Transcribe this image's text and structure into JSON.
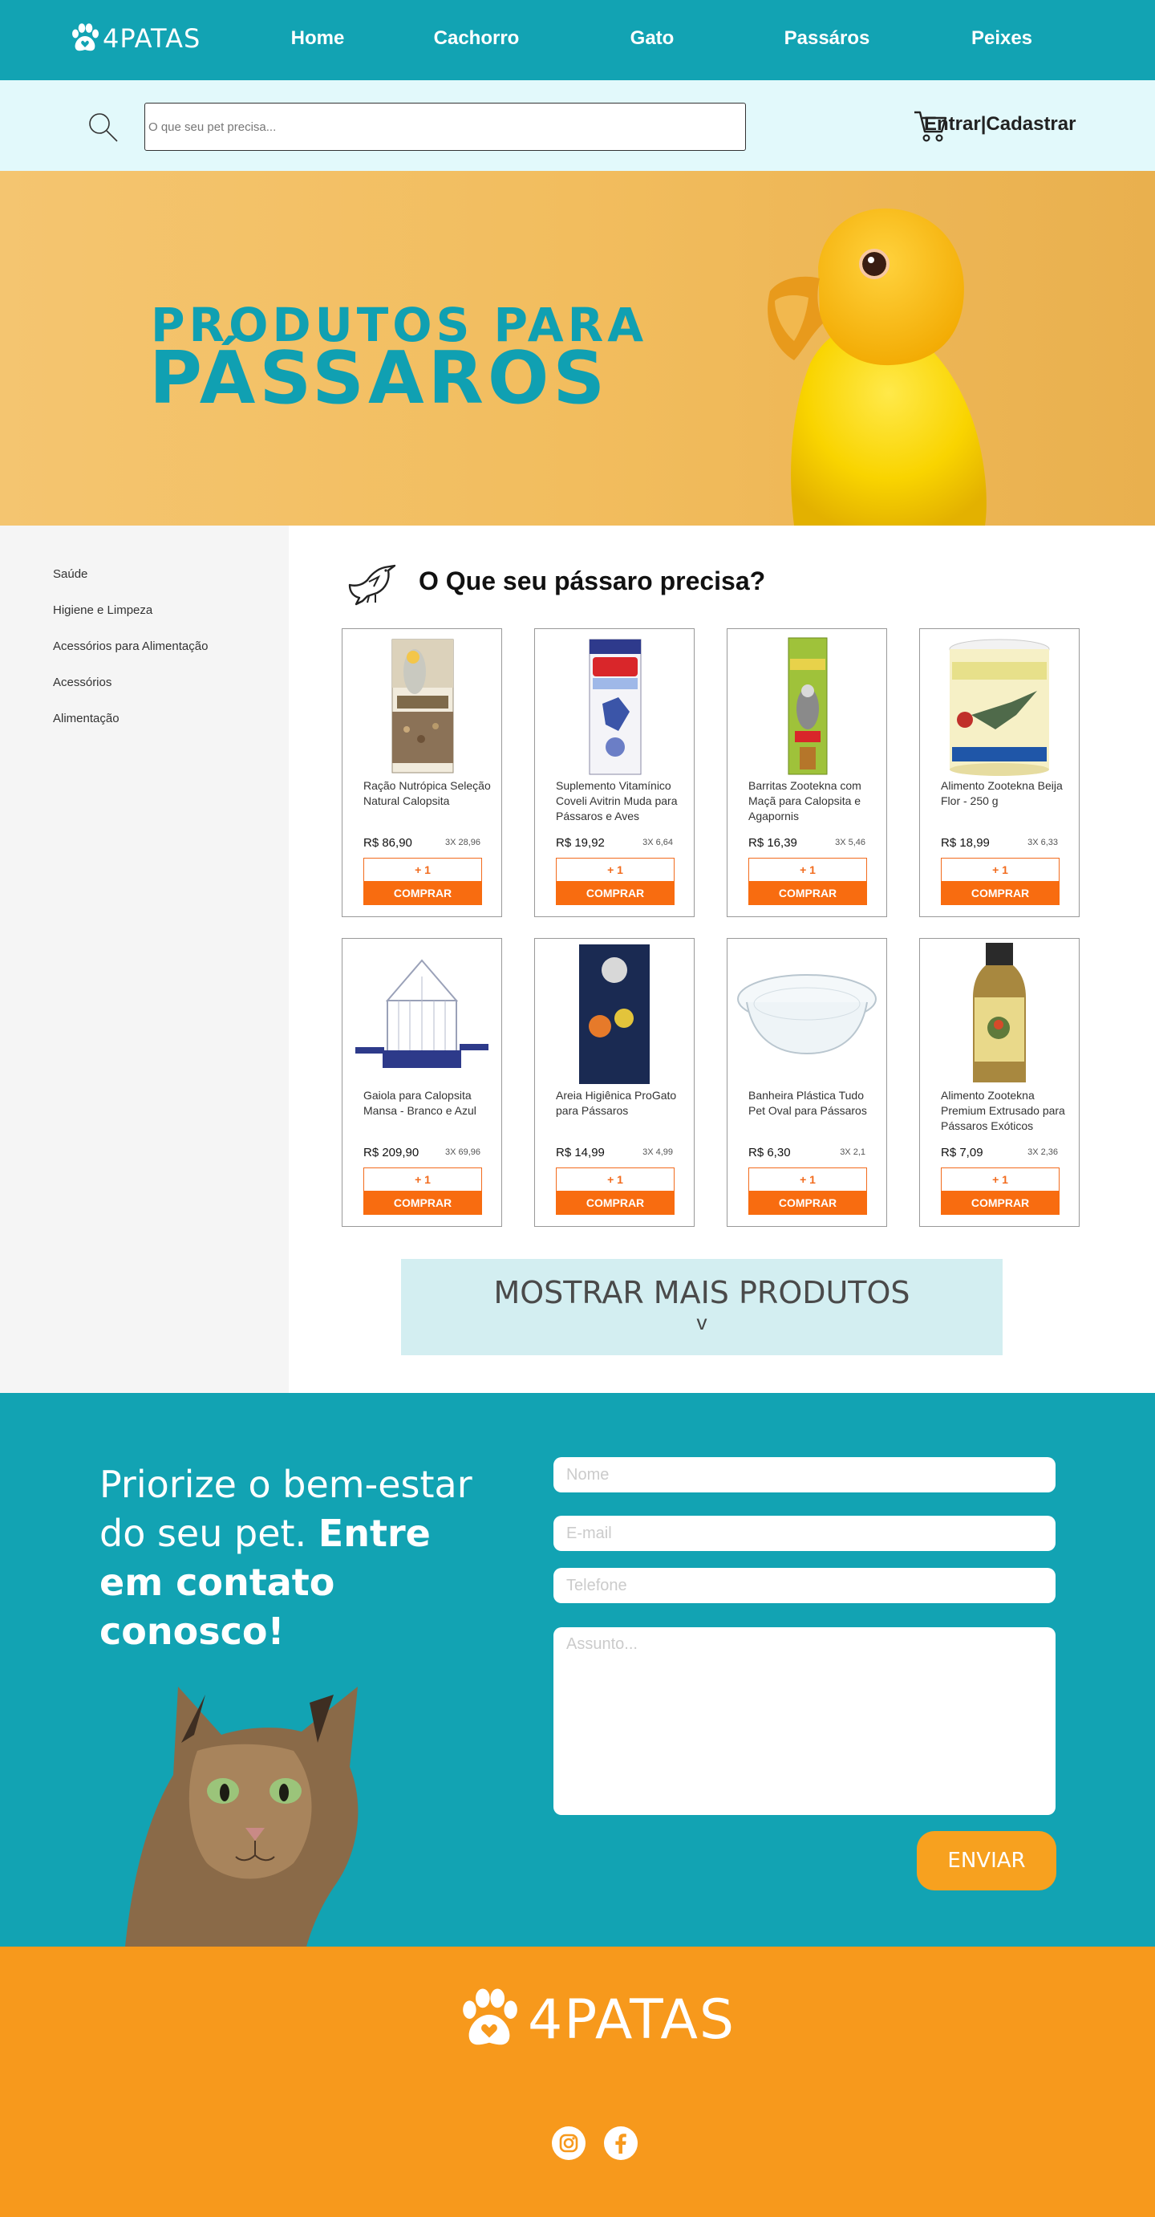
{
  "brand": {
    "name": "4PATAS"
  },
  "nav": {
    "links": [
      {
        "label": "Home"
      },
      {
        "label": "Cachorro"
      },
      {
        "label": "Gato"
      },
      {
        "label": "Passáros"
      },
      {
        "label": "Peixes"
      }
    ]
  },
  "search": {
    "placeholder": "O que seu pet precisa..."
  },
  "auth": {
    "login": "Entrar",
    "separator": "|",
    "register": "Cadastrar"
  },
  "hero": {
    "line1": "PRODUTOS PARA",
    "line2": "PÁSSAROS"
  },
  "sidebar": {
    "items": [
      {
        "label": "Saúde"
      },
      {
        "label": "Higiene e Limpeza"
      },
      {
        "label": "Acessórios para Alimentação"
      },
      {
        "label": "Acessórios"
      },
      {
        "label": "Alimentação"
      }
    ]
  },
  "section": {
    "title": "O Que seu pássaro precisa?"
  },
  "products": [
    {
      "name": "Ração Nutrópica Seleção Natural Calopsita",
      "price": "R$ 86,90",
      "installment": "3X 28,96",
      "add_label": "+ 1",
      "buy_label": "COMPRAR",
      "icon": "feed-box-image"
    },
    {
      "name": "Suplemento Vitamínico Coveli Avitrin Muda para Pássaros e Aves",
      "price": "R$ 19,92",
      "installment": "3X 6,64",
      "add_label": "+ 1",
      "buy_label": "COMPRAR",
      "icon": "supplement-box-image"
    },
    {
      "name": "Barritas Zootekna com Maçã para Calopsita e Agapornis",
      "price": "R$ 16,39",
      "installment": "3X 5,46",
      "add_label": "+ 1",
      "buy_label": "COMPRAR",
      "icon": "treat-bar-image"
    },
    {
      "name": "Alimento Zootekna Beija Flor - 250 g",
      "price": "R$ 18,99",
      "installment": "3X 6,33",
      "add_label": "+ 1",
      "buy_label": "COMPRAR",
      "icon": "hummingbird-food-image"
    },
    {
      "name": "Gaiola para Calopsita Mansa - Branco e Azul",
      "price": "R$ 209,90",
      "installment": "3X 69,96",
      "add_label": "+ 1",
      "buy_label": "COMPRAR",
      "icon": "cage-image"
    },
    {
      "name": "Areia Higiênica ProGato para Pássaros",
      "price": "R$ 14,99",
      "installment": "3X 4,99",
      "add_label": "+ 1",
      "buy_label": "COMPRAR",
      "icon": "sand-bag-image"
    },
    {
      "name": "Banheira Plástica Tudo Pet Oval para Pássaros",
      "price": "R$ 6,30",
      "installment": "3X 2,1",
      "add_label": "+ 1",
      "buy_label": "COMPRAR",
      "icon": "bath-tub-image"
    },
    {
      "name": "Alimento Zootekna Premium Extrusado para Pássaros Exóticos",
      "price": "R$ 7,09",
      "installment": "3X 2,36",
      "add_label": "+ 1",
      "buy_label": "COMPRAR",
      "icon": "exotic-food-jar-image"
    }
  ],
  "more": {
    "label": "MOSTRAR MAIS PRODUTOS",
    "arrow": "v"
  },
  "contact": {
    "text_regular": "Priorize o bem-estar do seu pet. ",
    "text_bold": "Entre em contato conosco!",
    "fields": {
      "name_placeholder": "Nome",
      "email_placeholder": "E-mail",
      "phone_placeholder": "Telefone",
      "subject_placeholder": "Assunto..."
    },
    "send_label": "ENVIAR"
  },
  "footer": {
    "brand": "4PATAS",
    "social": [
      "instagram-icon",
      "facebook-icon"
    ]
  },
  "colors": {
    "teal": "#12a3b3",
    "orange": "#f7991c",
    "buy": "#f86c10",
    "light_teal": "#e2f9fb"
  }
}
